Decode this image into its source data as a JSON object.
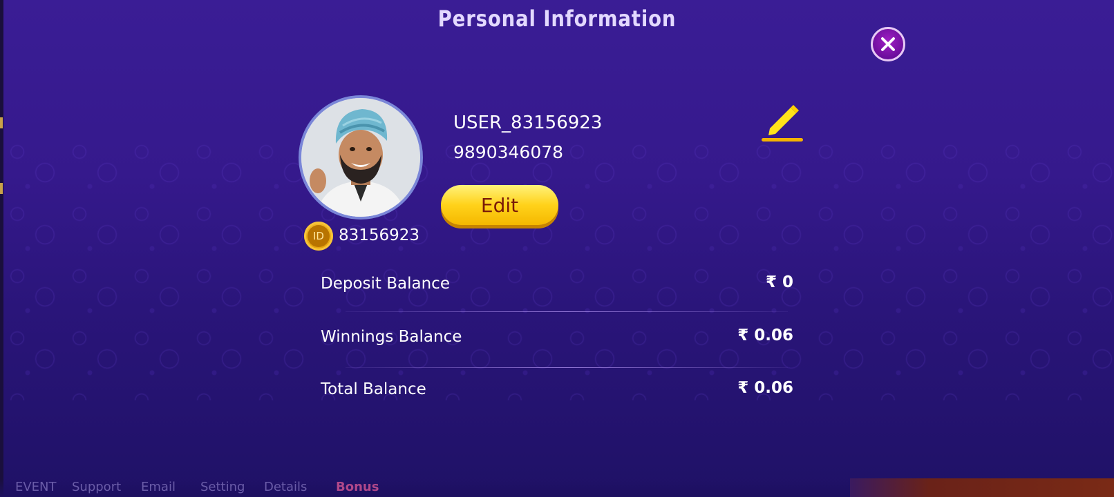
{
  "dialog": {
    "title": "Personal Information",
    "close_icon": "close-icon"
  },
  "profile": {
    "username": "USER_83156923",
    "phone": "9890346078",
    "edit_label": "Edit",
    "edit_icon": "pencil-icon",
    "id_badge_label": "ID",
    "id_value": "83156923"
  },
  "balances": [
    {
      "label": "Deposit Balance",
      "value": "₹ 0"
    },
    {
      "label": "Winnings Balance",
      "value": "₹ 0.06"
    },
    {
      "label": "Total Balance",
      "value": "₹ 0.06"
    }
  ],
  "background_tabs": [
    "EVENT",
    "Support",
    "Email",
    "Setting",
    "Details",
    "Bonus"
  ],
  "colors": {
    "background": "#35198c",
    "accent_yellow": "#ffd21a",
    "close_button": "#8a14b4",
    "text": "#ffffff"
  }
}
